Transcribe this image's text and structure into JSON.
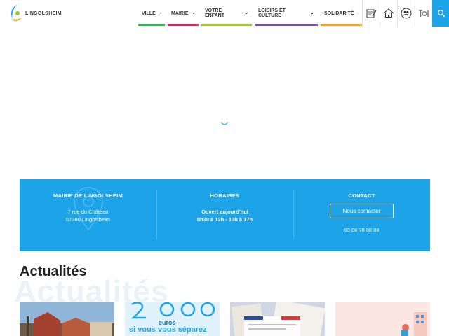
{
  "brand": {
    "name": "LINGOLSHEIM"
  },
  "nav": {
    "items": [
      {
        "label": "VILLE",
        "color": "#2fb65a"
      },
      {
        "label": "MAIRIE",
        "color": "#e1286a"
      },
      {
        "label": "VOTRE ENFANT",
        "color": "#9bc523"
      },
      {
        "label": "LOISIRS ET CULTURE",
        "color": "#7a4fb3"
      },
      {
        "label": "SOLIDARITÉ",
        "color": "#f2a31c"
      }
    ]
  },
  "tools": [
    "form-icon",
    "house-icon",
    "accessibility-icon",
    "toi-icon"
  ],
  "accent": "#1ca3e8",
  "info": {
    "mairie": {
      "title": "MAIRIE DE LINGOLSHEIM",
      "line1": "7 rue du Château",
      "line2": "67380 Lingolsheim"
    },
    "horaires": {
      "title": "HORAIRES",
      "line1": "Ouvert aujourd'hui",
      "line2": "8h30 à 12h - 13h à 17h"
    },
    "contact": {
      "title": "CONTACT",
      "button": "Nous contacter",
      "phone": "03 88 78 88 88"
    }
  },
  "news": {
    "title": "Actualités",
    "ghost": "Actualités",
    "card2": {
      "line1": "euros",
      "line2": "si vous vous séparez"
    }
  }
}
